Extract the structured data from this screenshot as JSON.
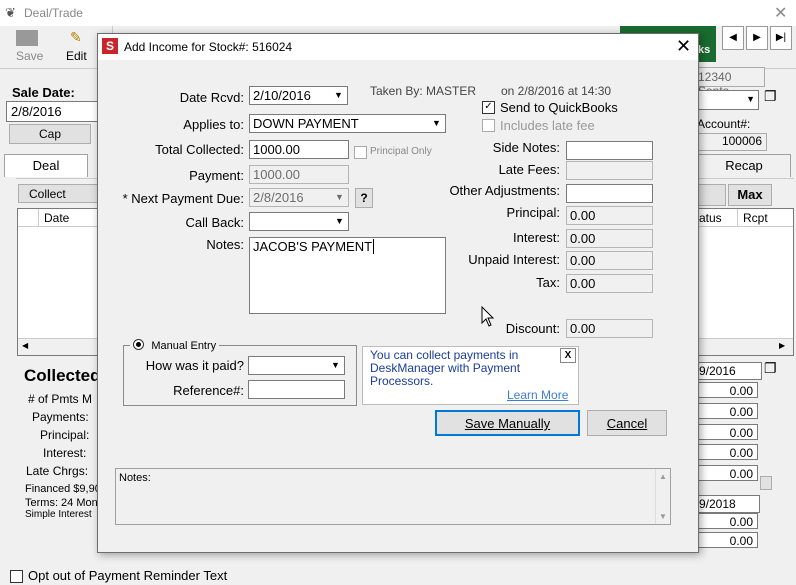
{
  "background": {
    "title": "Deal/Trade",
    "toolbar": {
      "save": "Save",
      "edit": "Edit"
    },
    "sale_date_label": "Sale Date:",
    "sale_date_value": "2/8/2016",
    "cap_button": "Cap",
    "address_value": "12340 Santa",
    "account_label": "Account#:",
    "account_value": "100006",
    "tabs": {
      "deal": "Deal",
      "recap": "Recap"
    },
    "collect_payment_button": "Collect Payme",
    "max_button": "Max",
    "table_headers": {
      "date": "Date",
      "status": "atus",
      "rcpt": "Rcpt"
    },
    "collected_heading": "Collected",
    "left_labels": [
      "# of Pmts M",
      "Payments:",
      "Principal:",
      "Interest:",
      "Late Chrgs:"
    ],
    "financed": "Financed $9,90",
    "terms": "Terms: 24 Mon",
    "simple_interest": "Simple Interest",
    "right_date1": "9/2016",
    "right_values": [
      "0.00",
      "0.00",
      "0.00",
      "0.00",
      "0.00"
    ],
    "right_date2": "9/2018",
    "right_values2": [
      "0.00",
      "0.00"
    ],
    "opt_out": "Opt out of Payment Reminder Text"
  },
  "dialog": {
    "title": "Add Income for Stock#: 516024",
    "date_rcvd_label": "Date Rcvd:",
    "date_rcvd_value": "2/10/2016",
    "taken_by": "Taken By: MASTER",
    "taken_on": "on 2/8/2016 at 14:30",
    "send_to_quickbooks": "Send to QuickBooks",
    "includes_late_fee": "Includes late fee",
    "applies_to_label": "Applies to:",
    "applies_to_value": "DOWN PAYMENT",
    "total_collected_label": "Total Collected:",
    "total_collected_value": "1000.00",
    "principal_only": "Principal Only",
    "payment_label": "Payment:",
    "payment_value": "1000.00",
    "next_payment_label": "* Next Payment Due:",
    "next_payment_value": "2/8/2016",
    "call_back_label": "Call Back:",
    "notes_label": "Notes:",
    "notes_value": "JACOB'S PAYMENT",
    "side_notes_label": "Side Notes:",
    "late_fees_label": "Late Fees:",
    "other_adjustments_label": "Other Adjustments:",
    "principal_label": "Principal:",
    "principal_value": "0.00",
    "interest_label": "Interest:",
    "interest_value": "0.00",
    "unpaid_interest_label": "Unpaid Interest:",
    "unpaid_interest_value": "0.00",
    "tax_label": "Tax:",
    "tax_value": "0.00",
    "discount_label": "Discount:",
    "discount_value": "0.00",
    "manual_entry_label": "Manual Entry",
    "how_paid_label": "How was it paid?",
    "reference_label": "Reference#:",
    "info_text": "You can collect payments in DeskManager with Payment Processors.",
    "learn_more": "Learn More",
    "save_manually": "Save Manually",
    "cancel": "Cancel",
    "bottom_notes_label": "Notes:"
  }
}
